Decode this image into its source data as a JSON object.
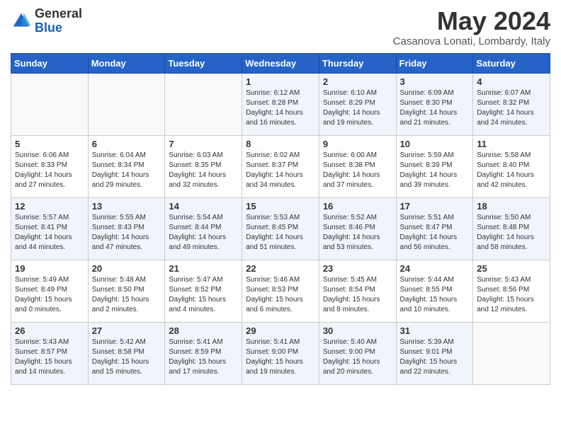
{
  "header": {
    "logo_line1": "General",
    "logo_line2": "Blue",
    "month_year": "May 2024",
    "location": "Casanova Lonati, Lombardy, Italy"
  },
  "days_of_week": [
    "Sunday",
    "Monday",
    "Tuesday",
    "Wednesday",
    "Thursday",
    "Friday",
    "Saturday"
  ],
  "weeks": [
    [
      {
        "day": "",
        "info": ""
      },
      {
        "day": "",
        "info": ""
      },
      {
        "day": "",
        "info": ""
      },
      {
        "day": "1",
        "info": "Sunrise: 6:12 AM\nSunset: 8:28 PM\nDaylight: 14 hours and 16 minutes."
      },
      {
        "day": "2",
        "info": "Sunrise: 6:10 AM\nSunset: 8:29 PM\nDaylight: 14 hours and 19 minutes."
      },
      {
        "day": "3",
        "info": "Sunrise: 6:09 AM\nSunset: 8:30 PM\nDaylight: 14 hours and 21 minutes."
      },
      {
        "day": "4",
        "info": "Sunrise: 6:07 AM\nSunset: 8:32 PM\nDaylight: 14 hours and 24 minutes."
      }
    ],
    [
      {
        "day": "5",
        "info": "Sunrise: 6:06 AM\nSunset: 8:33 PM\nDaylight: 14 hours and 27 minutes."
      },
      {
        "day": "6",
        "info": "Sunrise: 6:04 AM\nSunset: 8:34 PM\nDaylight: 14 hours and 29 minutes."
      },
      {
        "day": "7",
        "info": "Sunrise: 6:03 AM\nSunset: 8:35 PM\nDaylight: 14 hours and 32 minutes."
      },
      {
        "day": "8",
        "info": "Sunrise: 6:02 AM\nSunset: 8:37 PM\nDaylight: 14 hours and 34 minutes."
      },
      {
        "day": "9",
        "info": "Sunrise: 6:00 AM\nSunset: 8:38 PM\nDaylight: 14 hours and 37 minutes."
      },
      {
        "day": "10",
        "info": "Sunrise: 5:59 AM\nSunset: 8:39 PM\nDaylight: 14 hours and 39 minutes."
      },
      {
        "day": "11",
        "info": "Sunrise: 5:58 AM\nSunset: 8:40 PM\nDaylight: 14 hours and 42 minutes."
      }
    ],
    [
      {
        "day": "12",
        "info": "Sunrise: 5:57 AM\nSunset: 8:41 PM\nDaylight: 14 hours and 44 minutes."
      },
      {
        "day": "13",
        "info": "Sunrise: 5:55 AM\nSunset: 8:43 PM\nDaylight: 14 hours and 47 minutes."
      },
      {
        "day": "14",
        "info": "Sunrise: 5:54 AM\nSunset: 8:44 PM\nDaylight: 14 hours and 49 minutes."
      },
      {
        "day": "15",
        "info": "Sunrise: 5:53 AM\nSunset: 8:45 PM\nDaylight: 14 hours and 51 minutes."
      },
      {
        "day": "16",
        "info": "Sunrise: 5:52 AM\nSunset: 8:46 PM\nDaylight: 14 hours and 53 minutes."
      },
      {
        "day": "17",
        "info": "Sunrise: 5:51 AM\nSunset: 8:47 PM\nDaylight: 14 hours and 56 minutes."
      },
      {
        "day": "18",
        "info": "Sunrise: 5:50 AM\nSunset: 8:48 PM\nDaylight: 14 hours and 58 minutes."
      }
    ],
    [
      {
        "day": "19",
        "info": "Sunrise: 5:49 AM\nSunset: 8:49 PM\nDaylight: 15 hours and 0 minutes."
      },
      {
        "day": "20",
        "info": "Sunrise: 5:48 AM\nSunset: 8:50 PM\nDaylight: 15 hours and 2 minutes."
      },
      {
        "day": "21",
        "info": "Sunrise: 5:47 AM\nSunset: 8:52 PM\nDaylight: 15 hours and 4 minutes."
      },
      {
        "day": "22",
        "info": "Sunrise: 5:46 AM\nSunset: 8:53 PM\nDaylight: 15 hours and 6 minutes."
      },
      {
        "day": "23",
        "info": "Sunrise: 5:45 AM\nSunset: 8:54 PM\nDaylight: 15 hours and 8 minutes."
      },
      {
        "day": "24",
        "info": "Sunrise: 5:44 AM\nSunset: 8:55 PM\nDaylight: 15 hours and 10 minutes."
      },
      {
        "day": "25",
        "info": "Sunrise: 5:43 AM\nSunset: 8:56 PM\nDaylight: 15 hours and 12 minutes."
      }
    ],
    [
      {
        "day": "26",
        "info": "Sunrise: 5:43 AM\nSunset: 8:57 PM\nDaylight: 15 hours and 14 minutes."
      },
      {
        "day": "27",
        "info": "Sunrise: 5:42 AM\nSunset: 8:58 PM\nDaylight: 15 hours and 15 minutes."
      },
      {
        "day": "28",
        "info": "Sunrise: 5:41 AM\nSunset: 8:59 PM\nDaylight: 15 hours and 17 minutes."
      },
      {
        "day": "29",
        "info": "Sunrise: 5:41 AM\nSunset: 9:00 PM\nDaylight: 15 hours and 19 minutes."
      },
      {
        "day": "30",
        "info": "Sunrise: 5:40 AM\nSunset: 9:00 PM\nDaylight: 15 hours and 20 minutes."
      },
      {
        "day": "31",
        "info": "Sunrise: 5:39 AM\nSunset: 9:01 PM\nDaylight: 15 hours and 22 minutes."
      },
      {
        "day": "",
        "info": ""
      }
    ]
  ]
}
